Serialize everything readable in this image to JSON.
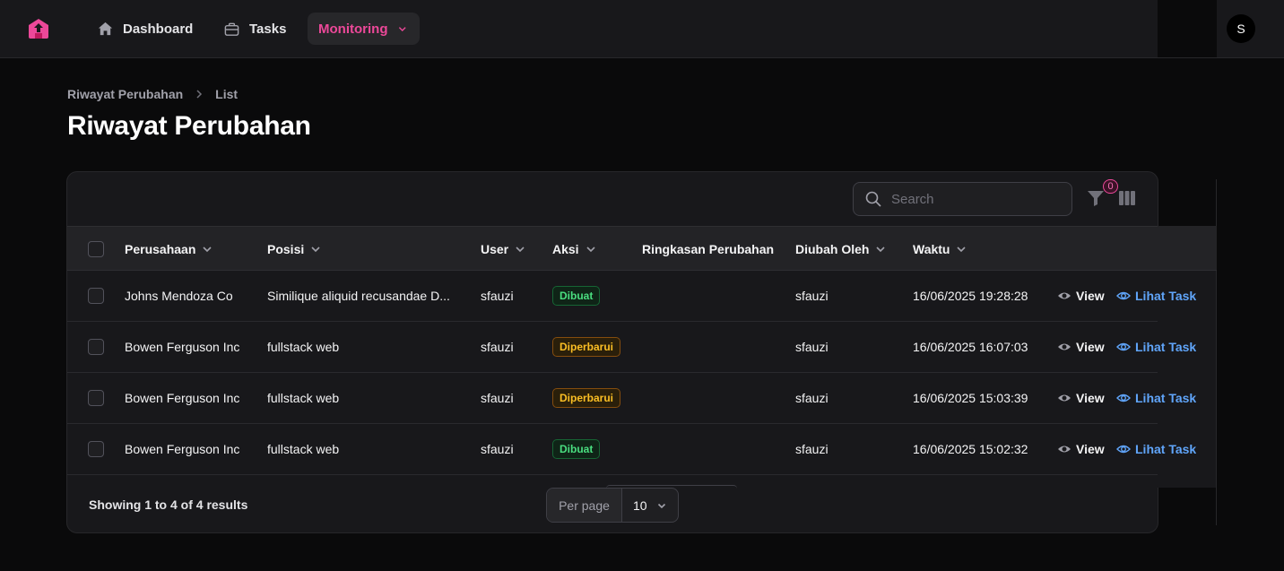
{
  "nav": {
    "items": [
      {
        "label": "Dashboard",
        "icon": "home-icon"
      },
      {
        "label": "Tasks",
        "icon": "briefcase-icon"
      },
      {
        "label": "Monitoring",
        "icon": "chevron-down-icon",
        "active": true
      }
    ],
    "avatar_initial": "S"
  },
  "breadcrumb": [
    "Riwayat Perubahan",
    "List"
  ],
  "page_title": "Riwayat Perubahan",
  "toolbar": {
    "search_placeholder": "Search",
    "filter_count": "0"
  },
  "table": {
    "columns": [
      "Perusahaan",
      "Posisi",
      "User",
      "Aksi",
      "Ringkasan Perubahan",
      "Diubah Oleh",
      "Waktu"
    ],
    "rows": [
      {
        "perusahaan": "Johns Mendoza Co",
        "posisi": "Similique aliquid recusandae D...",
        "user": "sfauzi",
        "aksi": "Dibuat",
        "ringkasan": "",
        "diubah_oleh": "sfauzi",
        "waktu": "16/06/2025 19:28:28"
      },
      {
        "perusahaan": "Bowen Ferguson Inc",
        "posisi": "fullstack web",
        "user": "sfauzi",
        "aksi": "Diperbarui",
        "ringkasan": "",
        "diubah_oleh": "sfauzi",
        "waktu": "16/06/2025 16:07:03"
      },
      {
        "perusahaan": "Bowen Ferguson Inc",
        "posisi": "fullstack web",
        "user": "sfauzi",
        "aksi": "Diperbarui",
        "ringkasan": "",
        "diubah_oleh": "sfauzi",
        "waktu": "16/06/2025 15:03:39"
      },
      {
        "perusahaan": "Bowen Ferguson Inc",
        "posisi": "fullstack web",
        "user": "sfauzi",
        "aksi": "Dibuat",
        "ringkasan": "",
        "diubah_oleh": "sfauzi",
        "waktu": "16/06/2025 15:02:32"
      }
    ],
    "row_actions": {
      "view": "View",
      "task": "Lihat Task"
    }
  },
  "footer": {
    "summary": "Showing 1 to 4 of 4 results",
    "per_page_label": "Per page",
    "per_page_value": "10"
  },
  "colors": {
    "accent": "#ec4899",
    "link": "#60a5fa",
    "created": "#4ade80",
    "updated": "#fbbf24"
  }
}
